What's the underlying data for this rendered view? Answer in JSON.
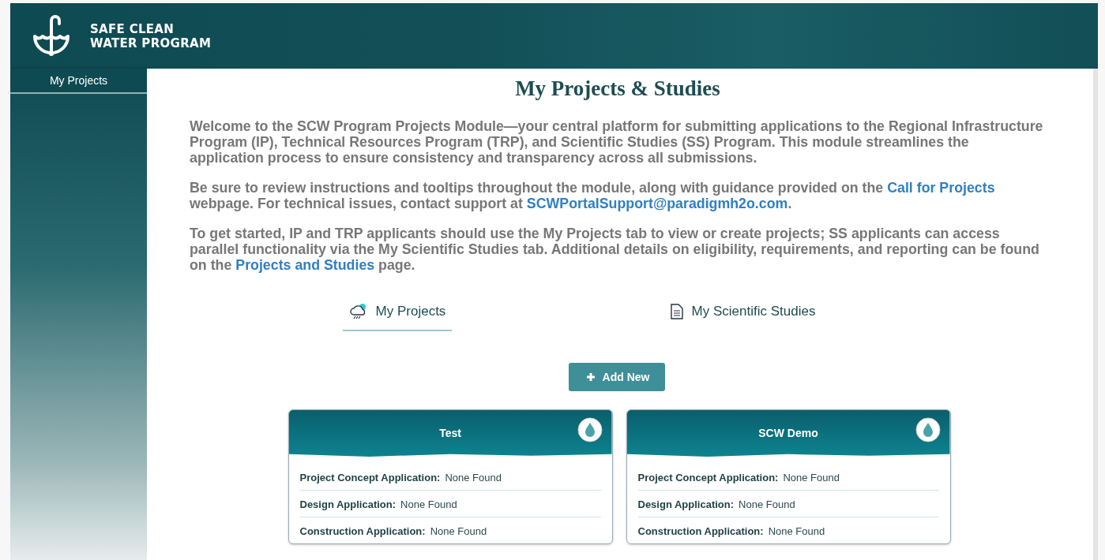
{
  "header": {
    "brand_line_1": "SAFE CLEAN",
    "brand_line_2": "WATER PROGRAM"
  },
  "sidebar": {
    "items": [
      {
        "label": "My Projects",
        "selected": true
      }
    ]
  },
  "page": {
    "title": "My Projects & Studies",
    "paragraphs": [
      [
        {
          "kind": "text",
          "text": "Welcome to the SCW Program Projects Module—your central platform for submitting applications to the Regional Infrastructure Program (IP), Technical Resources Program (TRP), and Scientific Studies (SS) Program. This module streamlines the application process to ensure consistency and transparency across all submissions."
        }
      ],
      [
        {
          "kind": "text",
          "text": "Be sure to review instructions and tooltips throughout the module, along with guidance provided on the "
        },
        {
          "kind": "link",
          "text": "Call for Projects"
        },
        {
          "kind": "text",
          "text": " webpage. For technical issues, contact support at "
        },
        {
          "kind": "link",
          "text": "SCWPortalSupport@paradigmh2o.com"
        },
        {
          "kind": "text",
          "text": "."
        }
      ],
      [
        {
          "kind": "text",
          "text": "To get started, IP and TRP applicants should use the My Projects tab to view or create projects; SS applicants can access parallel functionality via the My Scientific Studies tab. Additional details on eligibility, requirements, and reporting can be found on the "
        },
        {
          "kind": "link",
          "text": "Projects and Studies"
        },
        {
          "kind": "text",
          "text": " page."
        }
      ]
    ],
    "tabs": [
      {
        "label": "My Projects",
        "kind": "cloud",
        "selected": true
      },
      {
        "label": "My Scientific Studies",
        "kind": "document",
        "selected": false
      }
    ],
    "add_button": "Add New",
    "cards": [
      {
        "title": "Test",
        "rows": [
          {
            "label": "Project Concept Application:",
            "value": "None Found"
          },
          {
            "label": "Design Application:",
            "value": "None Found"
          },
          {
            "label": "Construction Application:",
            "value": "None Found"
          }
        ]
      },
      {
        "title": "SCW Demo",
        "rows": [
          {
            "label": "Project Concept Application:",
            "value": "None Found"
          },
          {
            "label": "Design Application:",
            "value": "None Found"
          },
          {
            "label": "Construction Application:",
            "value": "None Found"
          }
        ]
      }
    ]
  }
}
